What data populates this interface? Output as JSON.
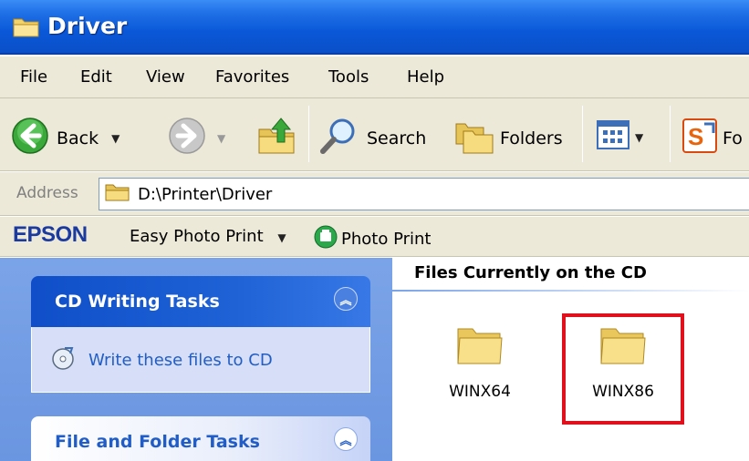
{
  "window": {
    "title": "Driver",
    "icon": "folder-icon"
  },
  "menu": {
    "items": [
      "File",
      "Edit",
      "View",
      "Favorites",
      "Tools",
      "Help"
    ]
  },
  "toolbar": {
    "back_label": "Back",
    "search_label": "Search",
    "folders_label": "Folders",
    "truncated_label": "Fo"
  },
  "address": {
    "label": "Address",
    "path": "D:\\Printer\\Driver"
  },
  "epson": {
    "logo": "EPSON",
    "easy_photo_print": "Easy Photo Print",
    "photo_print": "Photo Print"
  },
  "tasks": {
    "cd_writing": {
      "title": "CD Writing Tasks",
      "items": [
        "Write these files to CD"
      ]
    },
    "file_folder": {
      "title": "File and Folder Tasks"
    }
  },
  "content": {
    "section_title": "Files Currently on the CD",
    "files": [
      {
        "name": "WINX64",
        "type": "folder"
      },
      {
        "name": "WINX86",
        "type": "folder",
        "highlighted": true
      }
    ]
  },
  "colors": {
    "titlebar": "#0a58d8",
    "chrome": "#ece9d8",
    "taskpane": "#6a95e0",
    "highlight": "#e0101c"
  }
}
